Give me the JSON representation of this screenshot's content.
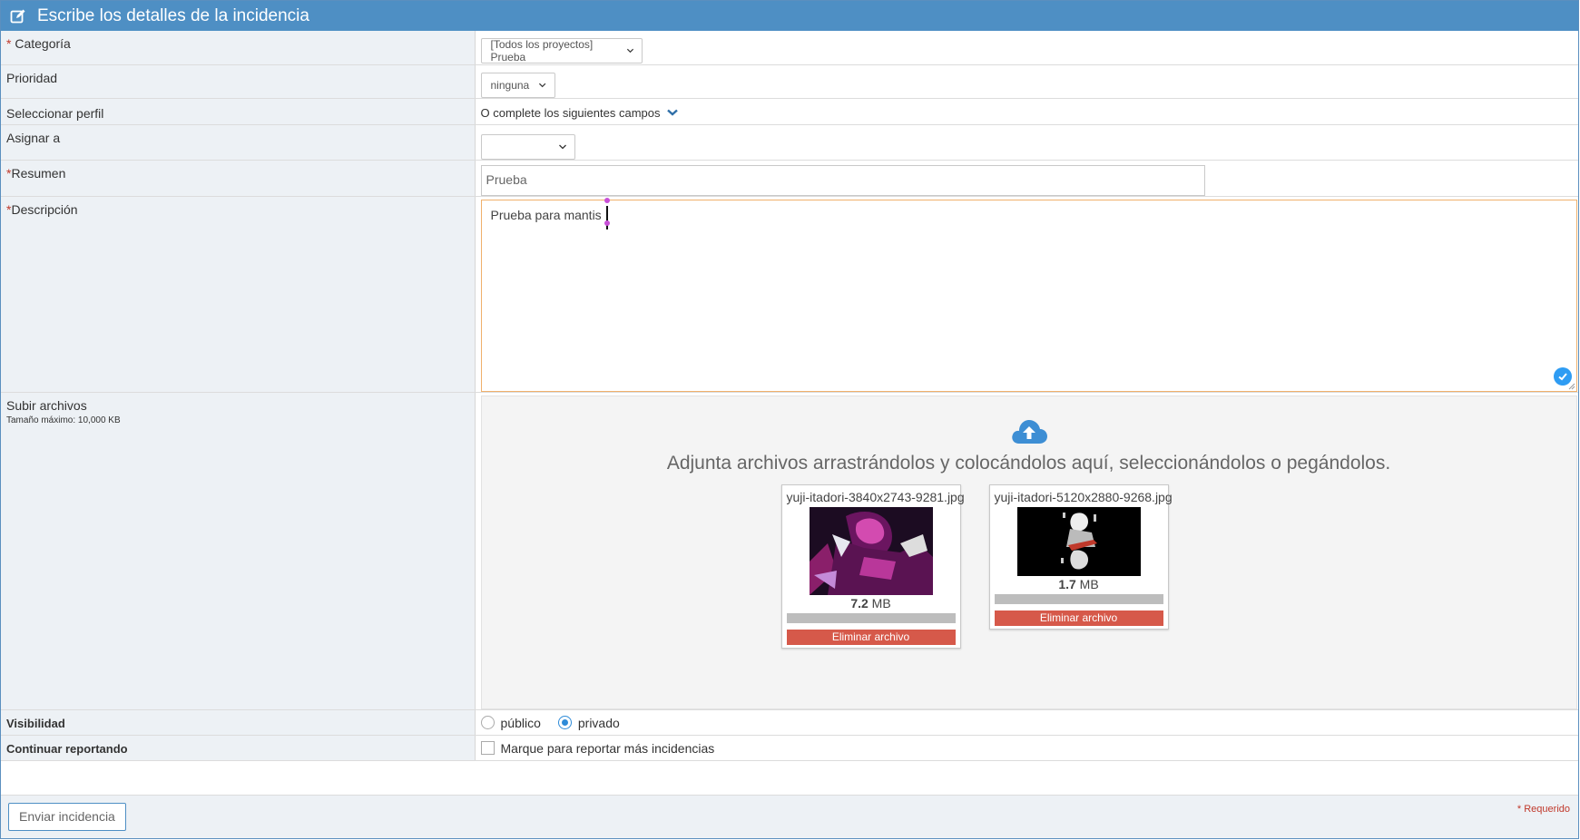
{
  "header": {
    "title": "Escribe los detalles de la incidencia",
    "icon": "edit-icon"
  },
  "form": {
    "category": {
      "required_mark": "*",
      "label": " Categoría",
      "value": "[Todos los proyectos] Prueba"
    },
    "priority": {
      "label": "Prioridad",
      "value": "ninguna"
    },
    "profile": {
      "label": "Seleccionar perfil",
      "link_text": "O complete los siguientes campos"
    },
    "assign": {
      "label": "Asignar a",
      "value": ""
    },
    "summary": {
      "required_mark": "*",
      "label": "Resumen",
      "value": "Prueba"
    },
    "description": {
      "required_mark": "*",
      "label": "Descripción",
      "value": "Prueba para mantis"
    },
    "upload": {
      "label": "Subir archivos",
      "max_size": "Tamaño máximo: 10,000 KB",
      "dropzone_text": "Adjunta archivos arrastrándolos y colocándolos aquí, seleccionándolos o pegándolos.",
      "files": [
        {
          "name": "yuji-itadori-3840x2743-9281.jpg",
          "size_value": "7.2",
          "size_unit": " MB",
          "remove_label": "Eliminar archivo",
          "progress": 1.0
        },
        {
          "name": "yuji-itadori-5120x2880-9268.jpg",
          "size_value": "1.7",
          "size_unit": " MB",
          "remove_label": "Eliminar archivo",
          "progress": 1.0
        }
      ]
    },
    "visibility": {
      "label": "Visibilidad",
      "public_label": "público",
      "private_label": "privado",
      "selected": "privado"
    },
    "continue": {
      "label": "Continuar reportando",
      "checkbox_label": "Marque para reportar más incidencias",
      "checked": false
    }
  },
  "footer": {
    "submit_label": "Enviar incidencia",
    "required_note": "* Requerido"
  },
  "colors": {
    "header": "#4e8fc4",
    "remove": "#d6594a",
    "accent": "#2e8bd8",
    "required": "#c0392b"
  }
}
